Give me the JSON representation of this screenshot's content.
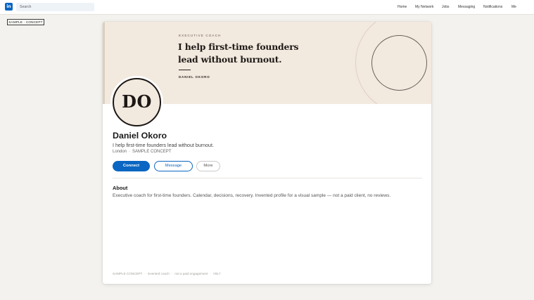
{
  "topbar": {
    "logo_text": "in",
    "search_placeholder": "Search",
    "nav": [
      "Home",
      "My Network",
      "Jobs",
      "Messaging",
      "Notifications",
      "Me"
    ]
  },
  "sample_tag": "SAMPLE · CONCEPT",
  "banner": {
    "eyebrow": "EXECUTIVE COACH",
    "headline_line1": "I help first-time founders",
    "headline_line2": "lead without burnout.",
    "name": "DANIEL OKORO"
  },
  "profile": {
    "initials": "DO",
    "name": "Daniel Okoro",
    "tagline": "I help first-time founders lead without burnout.",
    "location": "London",
    "meta_note": "SAMPLE CONCEPT"
  },
  "actions": {
    "connect": "Connect",
    "message": "Message",
    "more": "More"
  },
  "about": {
    "title": "About",
    "body": "Executive coach for first-time founders. Calendar, decisions, recovery. Invented profile for a visual sample — not a paid client, no reviews."
  },
  "footer": [
    "SAMPLE CONCEPT",
    "invented coach",
    "not a paid engagement",
    "V8L7"
  ],
  "colors": {
    "brand": "#0a66c2",
    "banner": "#f2e9df",
    "page_bg": "#f3f2ee"
  }
}
